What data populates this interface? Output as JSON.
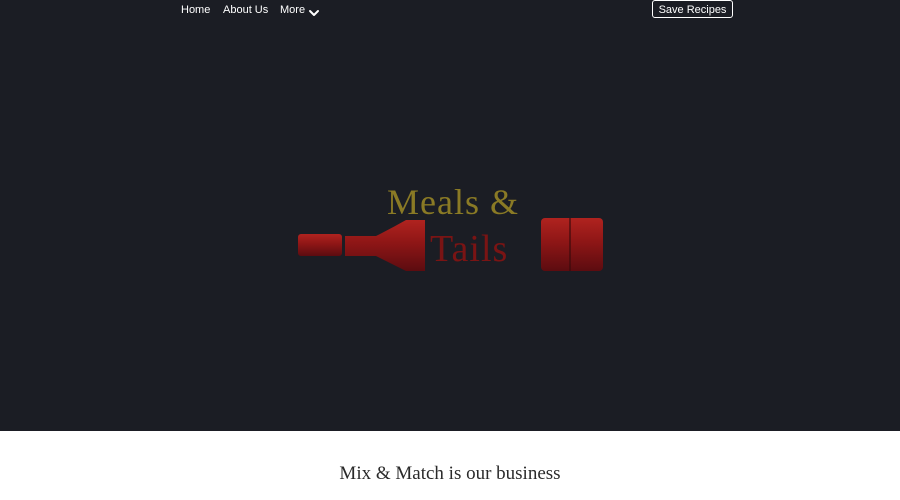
{
  "nav": {
    "items": [
      {
        "label": "Home"
      },
      {
        "label": "About Us"
      },
      {
        "label": "More"
      }
    ],
    "more_icon": "chevron-down-icon",
    "save_button_label": "Save Recipes"
  },
  "hero": {
    "background_color": "#1b1d24",
    "logo": {
      "line1": "Meals &",
      "line2": "Tails",
      "text_color": "#8a7a25",
      "bottle_color": "#9b1a1a"
    }
  },
  "tagline": "Mix & Match is our business"
}
